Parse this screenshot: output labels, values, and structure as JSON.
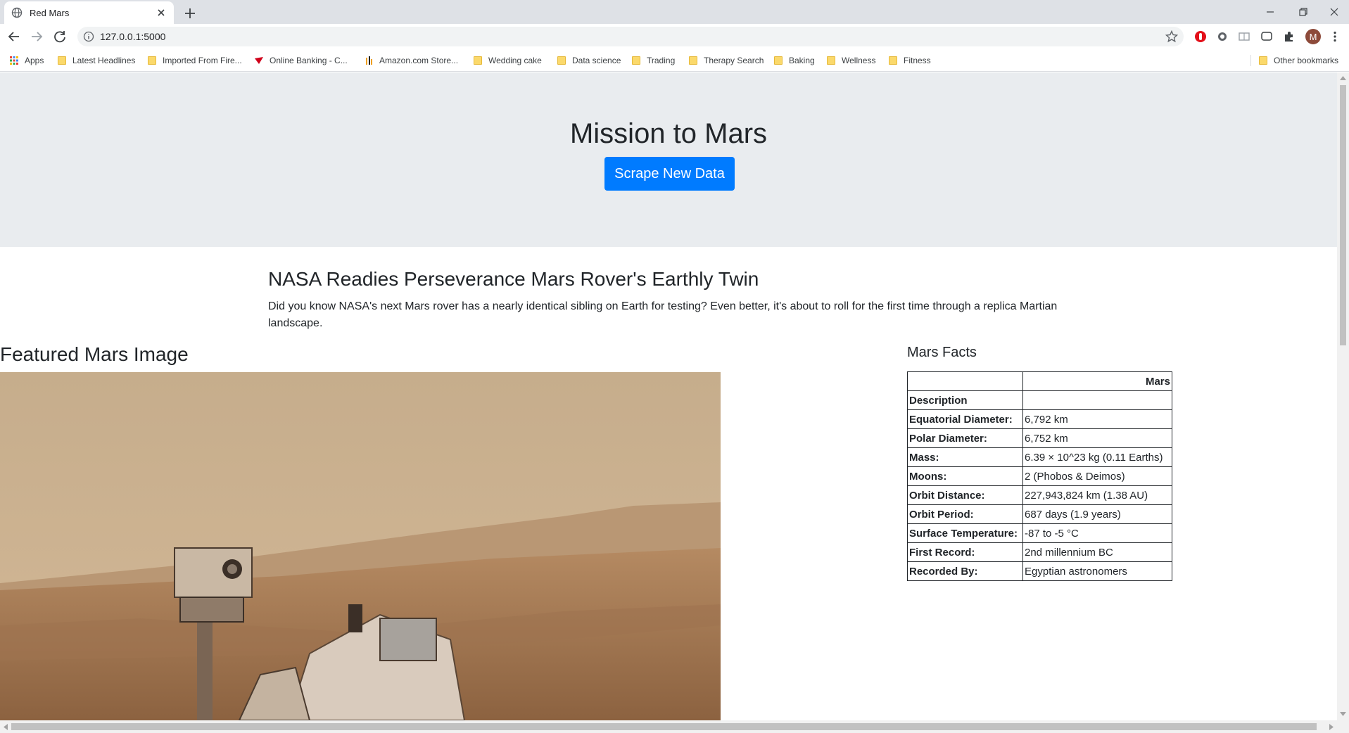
{
  "browser": {
    "tab_title": "Red Mars",
    "url": "127.0.0.1:5000",
    "profile_initial": "M",
    "bookmarks": [
      {
        "label": "Apps",
        "icon": "apps-grid-icon"
      },
      {
        "label": "Latest Headlines",
        "icon": "folder-icon"
      },
      {
        "label": "Imported From Fire...",
        "icon": "folder-icon"
      },
      {
        "label": "Online Banking - C...",
        "icon": "bank-logo-icon"
      },
      {
        "label": "Amazon.com Store...",
        "icon": "amazon-icon"
      },
      {
        "label": "Wedding cake",
        "icon": "folder-icon"
      },
      {
        "label": "Data science",
        "icon": "folder-icon"
      },
      {
        "label": "Trading",
        "icon": "folder-icon"
      },
      {
        "label": "Therapy Search",
        "icon": "folder-icon"
      },
      {
        "label": "Baking",
        "icon": "folder-icon"
      },
      {
        "label": "Wellness",
        "icon": "folder-icon"
      },
      {
        "label": "Fitness",
        "icon": "folder-icon"
      }
    ],
    "other_bookmarks": "Other bookmarks"
  },
  "page": {
    "title": "Mission to Mars",
    "scrape_button": "Scrape New Data",
    "news_title": "NASA Readies Perseverance Mars Rover's Earthly Twin",
    "news_paragraph": "Did you know NASA's next Mars rover has a nearly identical sibling on Earth for testing? Even better, it's about to roll for the first time through a replica Martian landscape.",
    "featured_title": "Featured Mars Image",
    "facts_title": "Mars Facts",
    "facts_table": {
      "column_header": "Mars",
      "rows": [
        {
          "label": "Description",
          "value": ""
        },
        {
          "label": "Equatorial Diameter:",
          "value": "6,792 km"
        },
        {
          "label": "Polar Diameter:",
          "value": "6,752 km"
        },
        {
          "label": "Mass:",
          "value": "6.39 × 10^23 kg (0.11 Earths)"
        },
        {
          "label": "Moons:",
          "value": "2 (Phobos & Deimos)"
        },
        {
          "label": "Orbit Distance:",
          "value": "227,943,824 km (1.38 AU)"
        },
        {
          "label": "Orbit Period:",
          "value": "687 days (1.9 years)"
        },
        {
          "label": "Surface Temperature:",
          "value": "-87 to -5 °C"
        },
        {
          "label": "First Record:",
          "value": "2nd millennium BC"
        },
        {
          "label": "Recorded By:",
          "value": "Egyptian astronomers"
        }
      ]
    }
  },
  "colors": {
    "primary_button": "#007bff",
    "jumbotron": "#e9ecef",
    "tabstrip": "#dee1e6"
  }
}
